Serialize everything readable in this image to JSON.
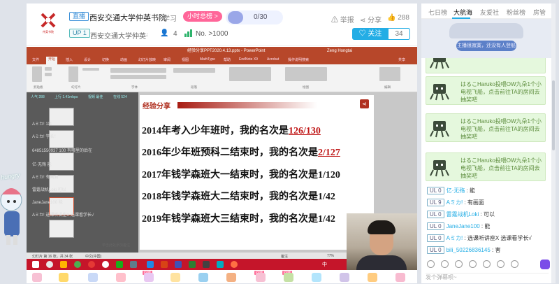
{
  "header": {
    "tag": "直播",
    "room_title": "西安交通大学仲英书院",
    "category": "学习",
    "hour_rank": "小时总榜",
    "hour_rank_arrow": ">",
    "fans_count": "0/30",
    "actions": {
      "report": "举报",
      "share": "分享",
      "like_count": "288"
    },
    "up_badge": "UP 1",
    "up_name": "西安交通大学仲英书院",
    "fans": "4",
    "rank": "No. >1000",
    "follow_label": "关注",
    "follow_count": "34",
    "logo_caption": "仲英书院"
  },
  "ppt": {
    "window_title": "经验分享PPT2020.4.13.pptx - PowerPoint",
    "user": "Zeng Hongtai",
    "share": "共享",
    "tabs": [
      "文件",
      "开始",
      "插入",
      "设计",
      "切换",
      "动画",
      "幻灯片放映",
      "审阅",
      "视图",
      "MathType",
      "帮助",
      "EndNote X9",
      "Acrobat",
      "操作说明搜索"
    ],
    "groups": [
      "剪贴板",
      "幻灯片",
      "字体",
      "段落",
      "绘图",
      "编辑"
    ],
    "status": {
      "slide_num": "幻灯片 第 16 张，共 34 张",
      "lang": "中文(中国)",
      "notes": "备注",
      "zoom": "77%"
    }
  },
  "slide": {
    "header": "经验分享",
    "lines": [
      {
        "pre": "2014年考入少年班时，我的名次是",
        "hl": "126/130"
      },
      {
        "pre": "2016年少年班预科二结束时，我的名次是",
        "hl": "2/127"
      },
      {
        "pre": "2017年钱学森班大一结束时，我的名次是1/120",
        "hl": ""
      },
      {
        "pre": "2018年钱学森班大二结束时，我的名次是1/42",
        "hl": ""
      },
      {
        "pre": "2019年钱学森班大三结束时，我的名次是1/42",
        "hl": ""
      }
    ]
  },
  "overlay": {
    "stats": [
      "人气 288",
      "上行 1.41mbps",
      "视频 最佳",
      "在线 524"
    ],
    "danmaku": [
      "Aミカ! 111",
      "Aミカ! 学长！",
      "64851550937 100 有哪里的后在",
      "亿·无殇 能",
      "Aミカ! 有画面",
      "雷霆战机Loki 可以",
      "JaneJane100 能",
      "Aミカ! 选课听讲座X 选课看学长√"
    ],
    "slide_note": "单击此处添加备注"
  },
  "taskbar": {
    "ime": "中"
  },
  "deco": {
    "hungry": "hungry"
  },
  "giftbar": {
    "tags": [
      "同城",
      "同城",
      "同城"
    ]
  },
  "right": {
    "tabs": [
      "七日榜",
      "大航海",
      "友爱社",
      "粉丝榜",
      "房管"
    ],
    "banner_button": "主播很寂寞，还没有人登船",
    "sys_messages": [
      "ほ",
      "はるこHaruko投喂OW九朵1个小电视飞船，点击前往TA的房间去抽奖吧",
      "はるこHaruko投喂OW九朵1个小电视飞船，点击前往TA的房间去抽奖吧",
      "はるこHaruko投喂OW九朵1个小电视飞船，点击前往TA的房间去抽奖吧"
    ],
    "chat": [
      {
        "lv": "UL 0",
        "name": "亿·无殇",
        "msg": "能"
      },
      {
        "lv": "UL 9",
        "name": "Aミカ!",
        "msg": "有画面"
      },
      {
        "lv": "UL 0",
        "name": "雷霆战机Loki",
        "msg": "可以"
      },
      {
        "lv": "UL 0",
        "name": "JaneJane100",
        "msg": "能"
      },
      {
        "lv": "UL 0",
        "name": "Aミカ!",
        "msg": "选课听讲座X 选课看学长√"
      },
      {
        "lv": "UL 0",
        "name": "bili_50226836145",
        "msg": "害"
      }
    ],
    "input_placeholder": "发个弹幕呗~"
  },
  "colors": {
    "accent": "#23ade5",
    "ppt_red": "#b7472a",
    "taskbar": "#c5152a",
    "pink": "#ff6699",
    "sys_green": "#e5f8dd"
  }
}
